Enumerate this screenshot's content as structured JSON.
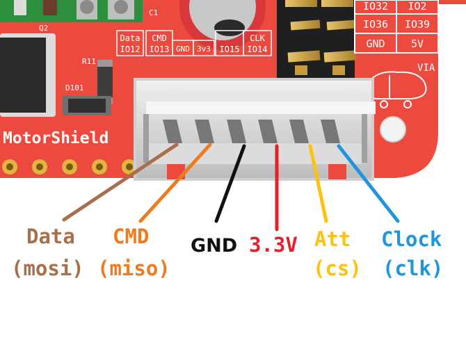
{
  "board": {
    "name": "MotorShield",
    "silkscreen": {
      "data_header": "Data",
      "data_pin": "IO12",
      "cmd_header": "CMD",
      "cmd_pin": "IO13",
      "gnd": "GND",
      "v33": "3v3",
      "att_pin": "IO15",
      "clk_header": "CLK",
      "clk_pin": "IO14",
      "r11": "R11",
      "d101": "D101",
      "q2": "Q2",
      "c1": "C1",
      "io32": "IO32",
      "io2": "IO2",
      "io36": "IO36",
      "io39": "IO39",
      "gnd2": "GND",
      "v5": "5V",
      "via": "VIA"
    }
  },
  "labels": {
    "data": {
      "line1": "Data",
      "line2": "(mosi)",
      "color": "#a86f4b"
    },
    "cmd": {
      "line1": "CMD",
      "line2": "(miso)",
      "color": "#f07a1e"
    },
    "gnd": {
      "line1": "GND",
      "color": "#111111"
    },
    "v33": {
      "line1": "3.3V",
      "color": "#e5202a"
    },
    "att": {
      "line1": "Att",
      "line2": "(cs)",
      "color": "#fdc10f"
    },
    "clock": {
      "line1": "Clock",
      "line2": "(clk)",
      "color": "#1f95dd"
    }
  }
}
